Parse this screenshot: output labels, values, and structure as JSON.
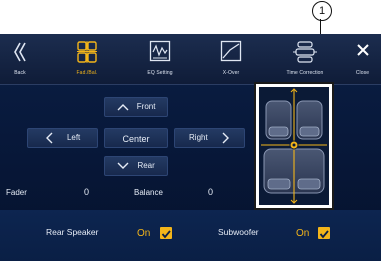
{
  "callout": {
    "number": "1"
  },
  "toolbar": {
    "items": [
      {
        "label": "Back",
        "icon": "back-chevron-icon"
      },
      {
        "label": "Fad./Bal.",
        "icon": "speaker-grid-icon",
        "active": true
      },
      {
        "label": "EQ Setting",
        "icon": "eq-icon"
      },
      {
        "label": "X-Over",
        "icon": "crossover-icon"
      },
      {
        "label": "Time Correction",
        "icon": "time-correction-icon"
      },
      {
        "label": "Close",
        "icon": "close-icon"
      }
    ]
  },
  "controls": {
    "front": "Front",
    "left": "Left",
    "center": "Center",
    "right": "Right",
    "rear": "Rear"
  },
  "readouts": {
    "fader_label": "Fader",
    "fader_value": "0",
    "balance_label": "Balance",
    "balance_value": "0"
  },
  "options": {
    "rear_speaker_label": "Rear Speaker",
    "rear_speaker_value": "On",
    "subwoofer_label": "Subwoofer",
    "subwoofer_value": "On"
  },
  "colors": {
    "accent": "#f3b51a",
    "background": "#0b1f45"
  }
}
